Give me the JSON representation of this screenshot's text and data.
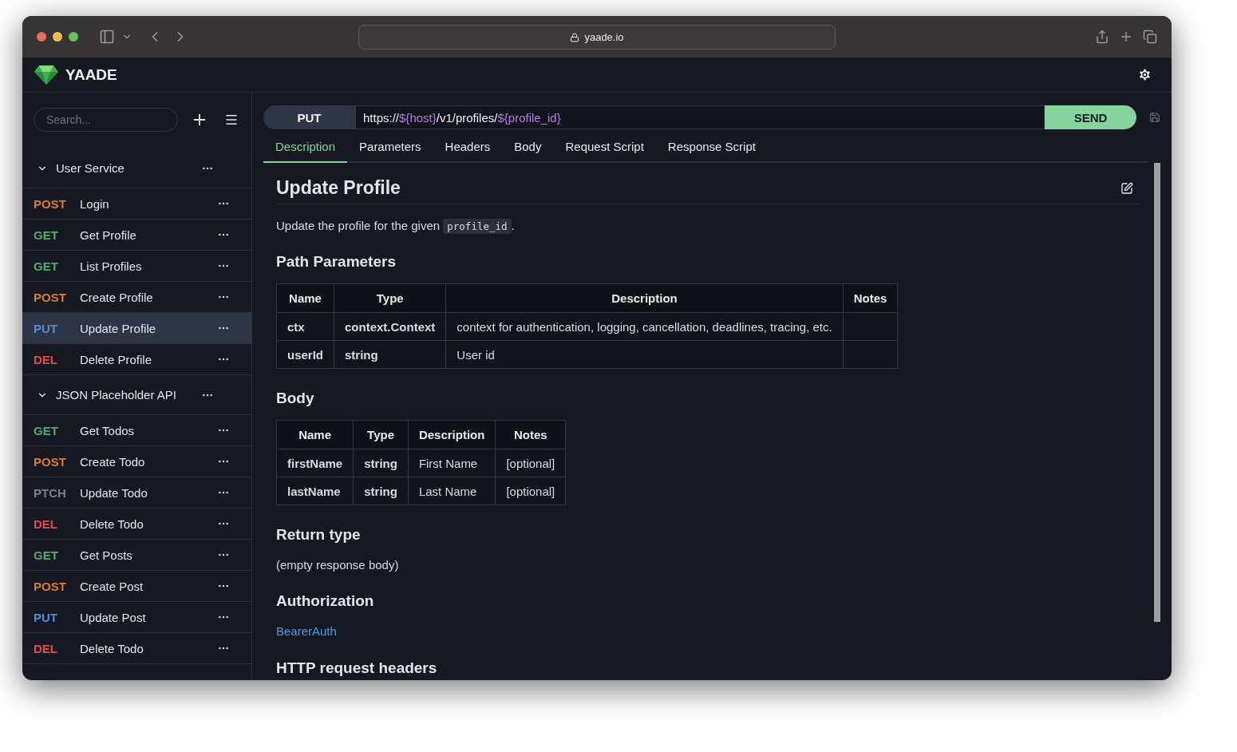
{
  "browser": {
    "address": "yaade.io"
  },
  "app": {
    "title": "YAADE"
  },
  "sidebar": {
    "search": {
      "placeholder": "Search..."
    },
    "collections": [
      {
        "name": "User Service",
        "expanded": true,
        "requests": [
          {
            "method": "POST",
            "color": "#dd7a33",
            "name": "Login",
            "selected": false
          },
          {
            "method": "GET",
            "color": "#4fae6e",
            "name": "Get Profile",
            "selected": false
          },
          {
            "method": "GET",
            "color": "#4fae6e",
            "name": "List Profiles",
            "selected": false
          },
          {
            "method": "POST",
            "color": "#dd7a33",
            "name": "Create Profile",
            "selected": false
          },
          {
            "method": "PUT",
            "color": "#4a8fd6",
            "name": "Update Profile",
            "selected": true
          },
          {
            "method": "DEL",
            "color": "#e04b4b",
            "name": "Delete Profile",
            "selected": false
          }
        ]
      },
      {
        "name": "JSON Placeholder API",
        "expanded": true,
        "requests": [
          {
            "method": "GET",
            "color": "#4fae6e",
            "name": "Get Todos",
            "selected": false
          },
          {
            "method": "POST",
            "color": "#dd7a33",
            "name": "Create Todo",
            "selected": false
          },
          {
            "method": "PTCH",
            "color": "#76808f",
            "name": "Update Todo",
            "selected": false
          },
          {
            "method": "DEL",
            "color": "#e04b4b",
            "name": "Delete Todo",
            "selected": false
          },
          {
            "method": "GET",
            "color": "#4fae6e",
            "name": "Get Posts",
            "selected": false
          },
          {
            "method": "POST",
            "color": "#dd7a33",
            "name": "Create Post",
            "selected": false
          },
          {
            "method": "PUT",
            "color": "#4a8fd6",
            "name": "Update Post",
            "selected": false
          },
          {
            "method": "DEL",
            "color": "#e04b4b",
            "name": "Delete Todo",
            "selected": false
          }
        ]
      }
    ]
  },
  "request": {
    "method": "PUT",
    "url": [
      {
        "kind": "plain",
        "text": "https://"
      },
      {
        "kind": "variable",
        "text": "${host}"
      },
      {
        "kind": "plain",
        "text": "/v1/profiles/"
      },
      {
        "kind": "variable",
        "text": "${profile_id}"
      }
    ],
    "send": "SEND"
  },
  "tabs": [
    {
      "label": "Description",
      "selected": true
    },
    {
      "label": "Parameters",
      "selected": false
    },
    {
      "label": "Headers",
      "selected": false
    },
    {
      "label": "Body",
      "selected": false
    },
    {
      "label": "Request Script",
      "selected": false
    },
    {
      "label": "Response Script",
      "selected": false
    }
  ],
  "doc": {
    "title": "Update Profile",
    "intro": [
      {
        "kind": "text",
        "text": "Update the profile for the given "
      },
      {
        "kind": "code",
        "text": "profile_id"
      },
      {
        "kind": "text",
        "text": "."
      }
    ],
    "sections": [
      {
        "kind": "table",
        "heading": "Path Parameters",
        "columns": [
          "Name",
          "Type",
          "Description",
          "Notes"
        ],
        "rows": [
          [
            "ctx",
            "context.Context",
            "context for authentication, logging, cancellation, deadlines, tracing, etc."
          ],
          [
            "userId",
            "string",
            "User id"
          ]
        ]
      },
      {
        "kind": "table",
        "heading": "Body",
        "columns": [
          "Name",
          "Type",
          "Description",
          "Notes"
        ],
        "rows": [
          [
            "firstName",
            "string",
            "First Name",
            "[optional]"
          ],
          [
            "lastName",
            "string",
            "Last Name",
            "[optional]"
          ]
        ]
      },
      {
        "kind": "text",
        "heading": "Return type",
        "text": "(empty response body)"
      },
      {
        "kind": "link",
        "heading": "Authorization",
        "text": "BearerAuth"
      },
      {
        "kind": "heading",
        "heading": "HTTP request headers"
      }
    ]
  }
}
